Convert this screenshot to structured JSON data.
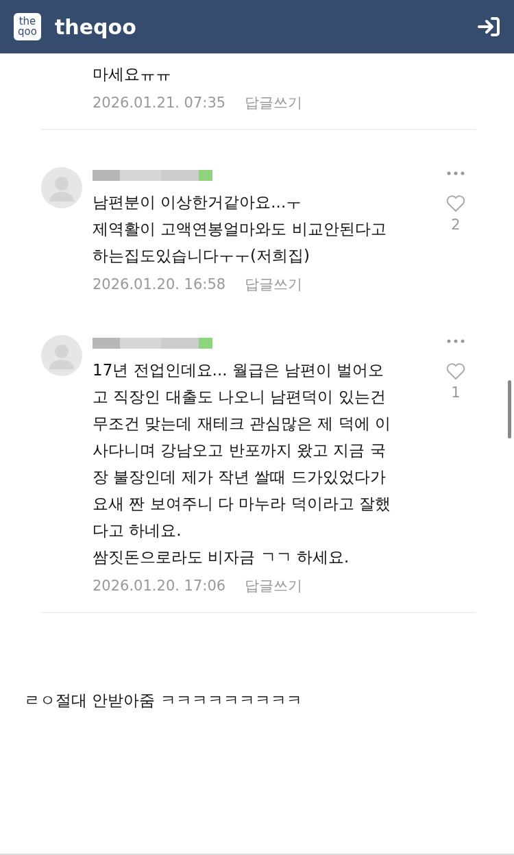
{
  "app_bar": {
    "logo_lines": [
      "the",
      "qoo"
    ],
    "title": "theqoo"
  },
  "comments": [
    {
      "kind": "partial",
      "lines": [
        "마세요ㅠㅠ"
      ],
      "timestamp": "2026.01.21. 07:35",
      "reply": "답글쓰기"
    },
    {
      "kind": "full",
      "lines": [
        "남편분이 이상한거같아요...ㅜ",
        "제역활이 고액연봉얼마와도 비교안된다고",
        "하는집도있습니다ㅜㅜ(저희집)"
      ],
      "timestamp": "2026.01.20. 16:58",
      "reply": "답글쓰기",
      "likes": "2"
    },
    {
      "kind": "full",
      "lines": [
        "17년 전업인데요... 월급은 남편이 벌어오",
        "고 직장인 대출도 나오니 남편덕이 있는건",
        "무조건 맞는데 재테크 관심많은 제 덕에 이",
        "사다니며 강남오고 반포까지 왔고 지금 국",
        "장 불장인데 제가 작년 쌀때 드가있었다가",
        "요새 짠 보여주니 다 마누라 덕이라고 잘했",
        "다고 하네요.",
        "쌈짓돈으로라도 비자금 ㄱㄱ 하세요."
      ],
      "timestamp": "2026.01.20. 17:06",
      "reply": "답글쓰기",
      "likes": "1"
    }
  ],
  "post_text": "ㄹㅇ절대 안받아줌 ㅋㅋㅋㅋㅋㅋㅋㅋㅋ"
}
